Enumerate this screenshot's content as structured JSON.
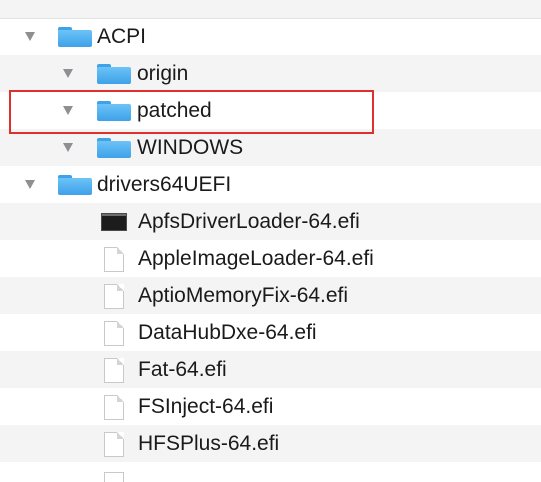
{
  "tree": {
    "items": [
      {
        "label": "ACPI",
        "kind": "folder",
        "expanded": true
      },
      {
        "label": "origin",
        "kind": "folder",
        "expanded": true
      },
      {
        "label": "patched",
        "kind": "folder",
        "expanded": true,
        "highlighted": true
      },
      {
        "label": "WINDOWS",
        "kind": "folder",
        "expanded": true
      },
      {
        "label": "drivers64UEFI",
        "kind": "folder",
        "expanded": true
      },
      {
        "label": "ApfsDriverLoader-64.efi",
        "kind": "executable-file"
      },
      {
        "label": "AppleImageLoader-64.efi",
        "kind": "file"
      },
      {
        "label": "AptioMemoryFix-64.efi",
        "kind": "file"
      },
      {
        "label": "DataHubDxe-64.efi",
        "kind": "file"
      },
      {
        "label": "Fat-64.efi",
        "kind": "file"
      },
      {
        "label": "FSInject-64.efi",
        "kind": "file"
      },
      {
        "label": "HFSPlus-64.efi",
        "kind": "file"
      }
    ]
  },
  "colors": {
    "folder": "#3ea1e9",
    "highlight_border": "#e0302b",
    "alt_row": "#f4f4f5"
  }
}
